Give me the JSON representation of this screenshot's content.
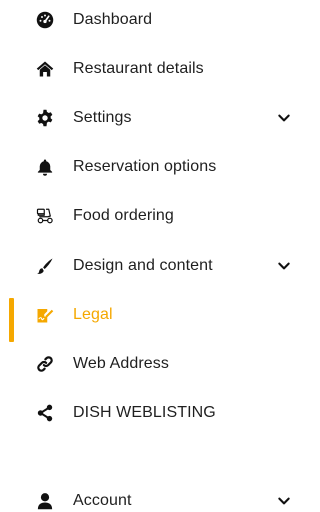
{
  "colors": {
    "accent": "#f5a800",
    "text": "#1f1f1f",
    "icon": "#111111"
  },
  "nav": {
    "items": [
      {
        "label": "Dashboard",
        "icon": "speedometer-icon",
        "has_chevron": false
      },
      {
        "label": "Restaurant details",
        "icon": "home-icon",
        "has_chevron": false
      },
      {
        "label": "Settings",
        "icon": "gear-icon",
        "has_chevron": true
      },
      {
        "label": "Reservation options",
        "icon": "bell-icon",
        "has_chevron": false
      },
      {
        "label": "Food ordering",
        "icon": "scooter-icon",
        "has_chevron": false
      },
      {
        "label": "Design and content",
        "icon": "brush-icon",
        "has_chevron": true
      },
      {
        "label": "Legal",
        "icon": "signature-icon",
        "has_chevron": false,
        "active": true
      },
      {
        "label": "Web Address",
        "icon": "link-icon",
        "has_chevron": false
      },
      {
        "label": "DISH WEBLISTING",
        "icon": "share-icon",
        "has_chevron": false
      }
    ],
    "account": {
      "label": "Account",
      "icon": "user-icon",
      "has_chevron": true
    }
  }
}
